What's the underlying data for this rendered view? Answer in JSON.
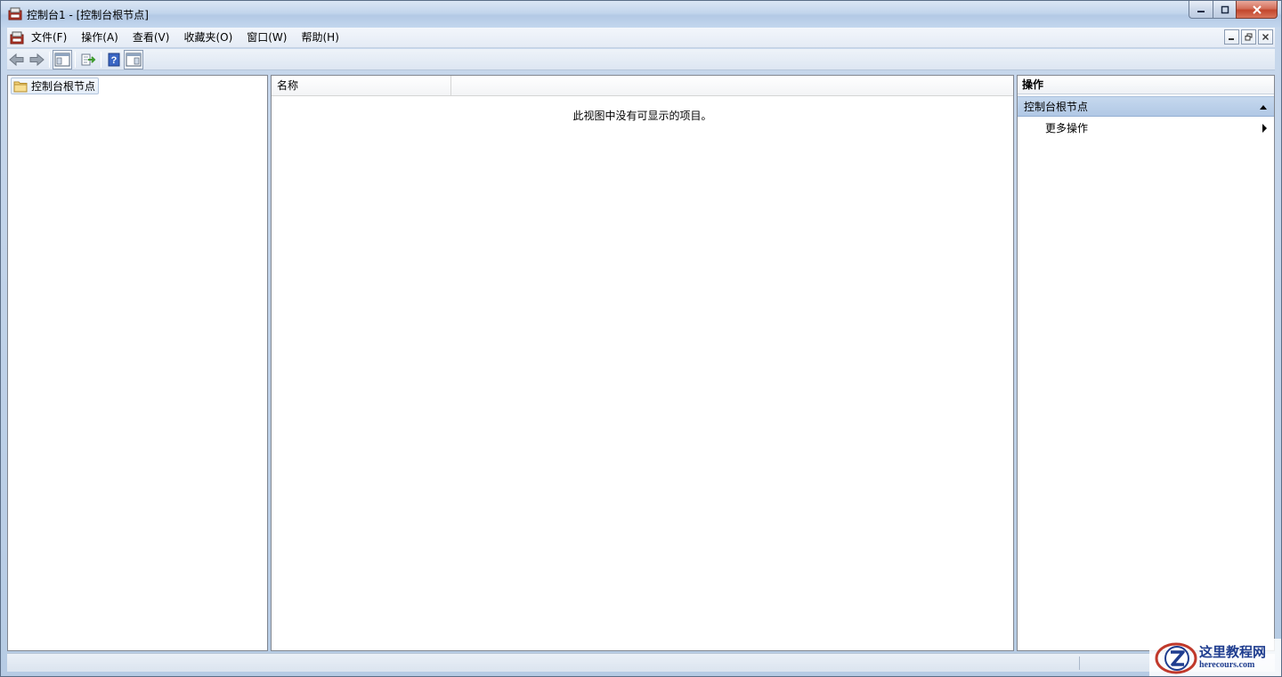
{
  "window": {
    "title": "控制台1 - [控制台根节点]"
  },
  "menu": {
    "items": [
      {
        "label": "文件(F)"
      },
      {
        "label": "操作(A)"
      },
      {
        "label": "查看(V)"
      },
      {
        "label": "收藏夹(O)"
      },
      {
        "label": "窗口(W)"
      },
      {
        "label": "帮助(H)"
      }
    ]
  },
  "toolbar": {
    "icons": [
      "back-arrow-icon",
      "forward-arrow-icon",
      "show-hide-console-tree-icon",
      "export-list-icon",
      "help-icon",
      "show-hide-action-pane-icon"
    ]
  },
  "tree": {
    "root_label": "控制台根节点"
  },
  "list": {
    "columns": [
      {
        "label": "名称"
      }
    ],
    "empty_message": "此视图中没有可显示的项目。"
  },
  "actions": {
    "title": "操作",
    "section_title": "控制台根节点",
    "items": [
      {
        "label": "更多操作"
      }
    ]
  },
  "watermark": {
    "cn": "这里教程网",
    "en": "herecours.com"
  },
  "colors": {
    "accent": "#1f3d8f",
    "selection": "#b1c8e5"
  }
}
